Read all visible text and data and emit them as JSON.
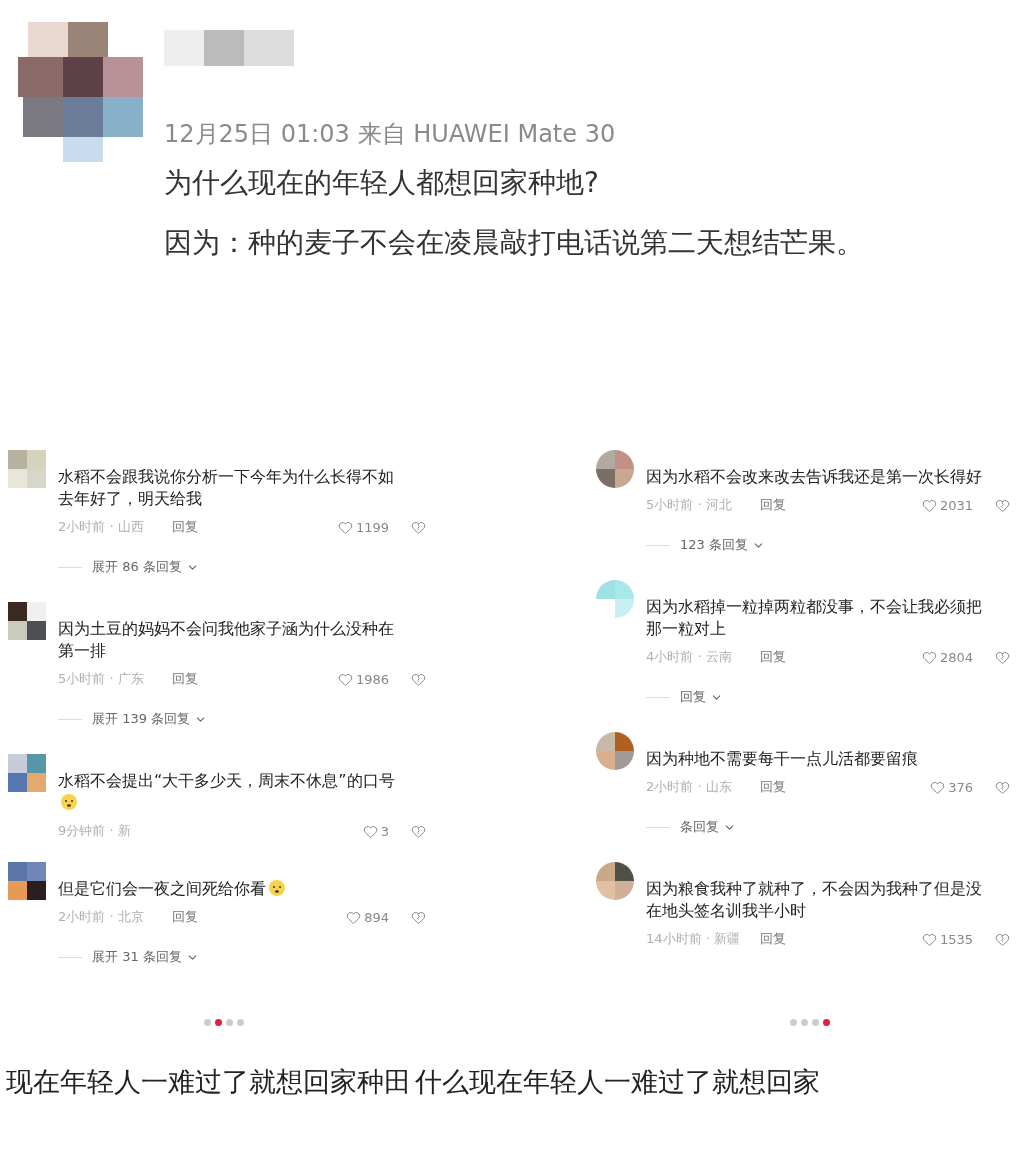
{
  "post": {
    "meta": "12月25日 01:03  来自 HUAWEI Mate 30",
    "title": "为什么现在的年轻人都想回家种地?",
    "body": "因为：种的麦子不会在凌晨敲打电话说第二天想结芒果。"
  },
  "panels": [
    {
      "comments": [
        {
          "text": "水稻不会跟我说你分析一下今年为什么长得不如去年好了，明天给我",
          "time": "2小时前 · 山西",
          "reply": "回复",
          "likes": "1199",
          "expand": "展开 86 条回复",
          "emoji": false
        },
        {
          "text": "因为土豆的妈妈不会问我他家子涵为什么没种在第一排",
          "time": "5小时前 · 广东",
          "reply": "回复",
          "likes": "1986",
          "expand": "展开 139 条回复",
          "emoji": false
        },
        {
          "text": "水稻不会提出“大干多少天，周末不休息”的口号",
          "time": "9分钟前 · 新",
          "likes": "3",
          "emoji": true
        },
        {
          "text": "但是它们会一夜之间死给你看",
          "time": "2小时前 · 北京",
          "reply": "回复",
          "likes": "894",
          "expand": "展开 31 条回复",
          "emoji": true
        }
      ],
      "dots": [
        {
          "selected": false
        },
        {
          "selected": true
        },
        {
          "selected": false
        },
        {
          "selected": false
        }
      ]
    },
    {
      "comments": [
        {
          "text": "因为水稻不会改来改去告诉我还是第一次长得好",
          "time": "5小时前 · 河北",
          "reply": "回复",
          "likes": "2031",
          "expand": "123 条回复",
          "emoji": false
        },
        {
          "text": "因为水稻掉一粒掉两粒都没事，不会让我必须把那一粒对上",
          "time": "4小时前 · 云南",
          "reply": "回复",
          "likes": "2804",
          "expand": "回复",
          "emoji": false
        },
        {
          "text": "因为种地不需要每干一点儿活都要留痕",
          "time": "2小时前 · 山东",
          "reply": "回复",
          "likes": "376",
          "expand": "条回复",
          "emoji": false
        },
        {
          "text": "因为粮食我种了就种了，不会因为我种了但是没在地头签名训我半小时",
          "time": "14小时前 · 新疆",
          "reply": "回复",
          "likes": "1535",
          "emoji": false
        }
      ],
      "dots": [
        {
          "selected": false
        },
        {
          "selected": false
        },
        {
          "selected": false
        },
        {
          "selected": true
        }
      ]
    }
  ],
  "footer": [
    "现在年轻人一难过了就想回家种田",
    "什么现在年轻人一难过了就想回家"
  ]
}
